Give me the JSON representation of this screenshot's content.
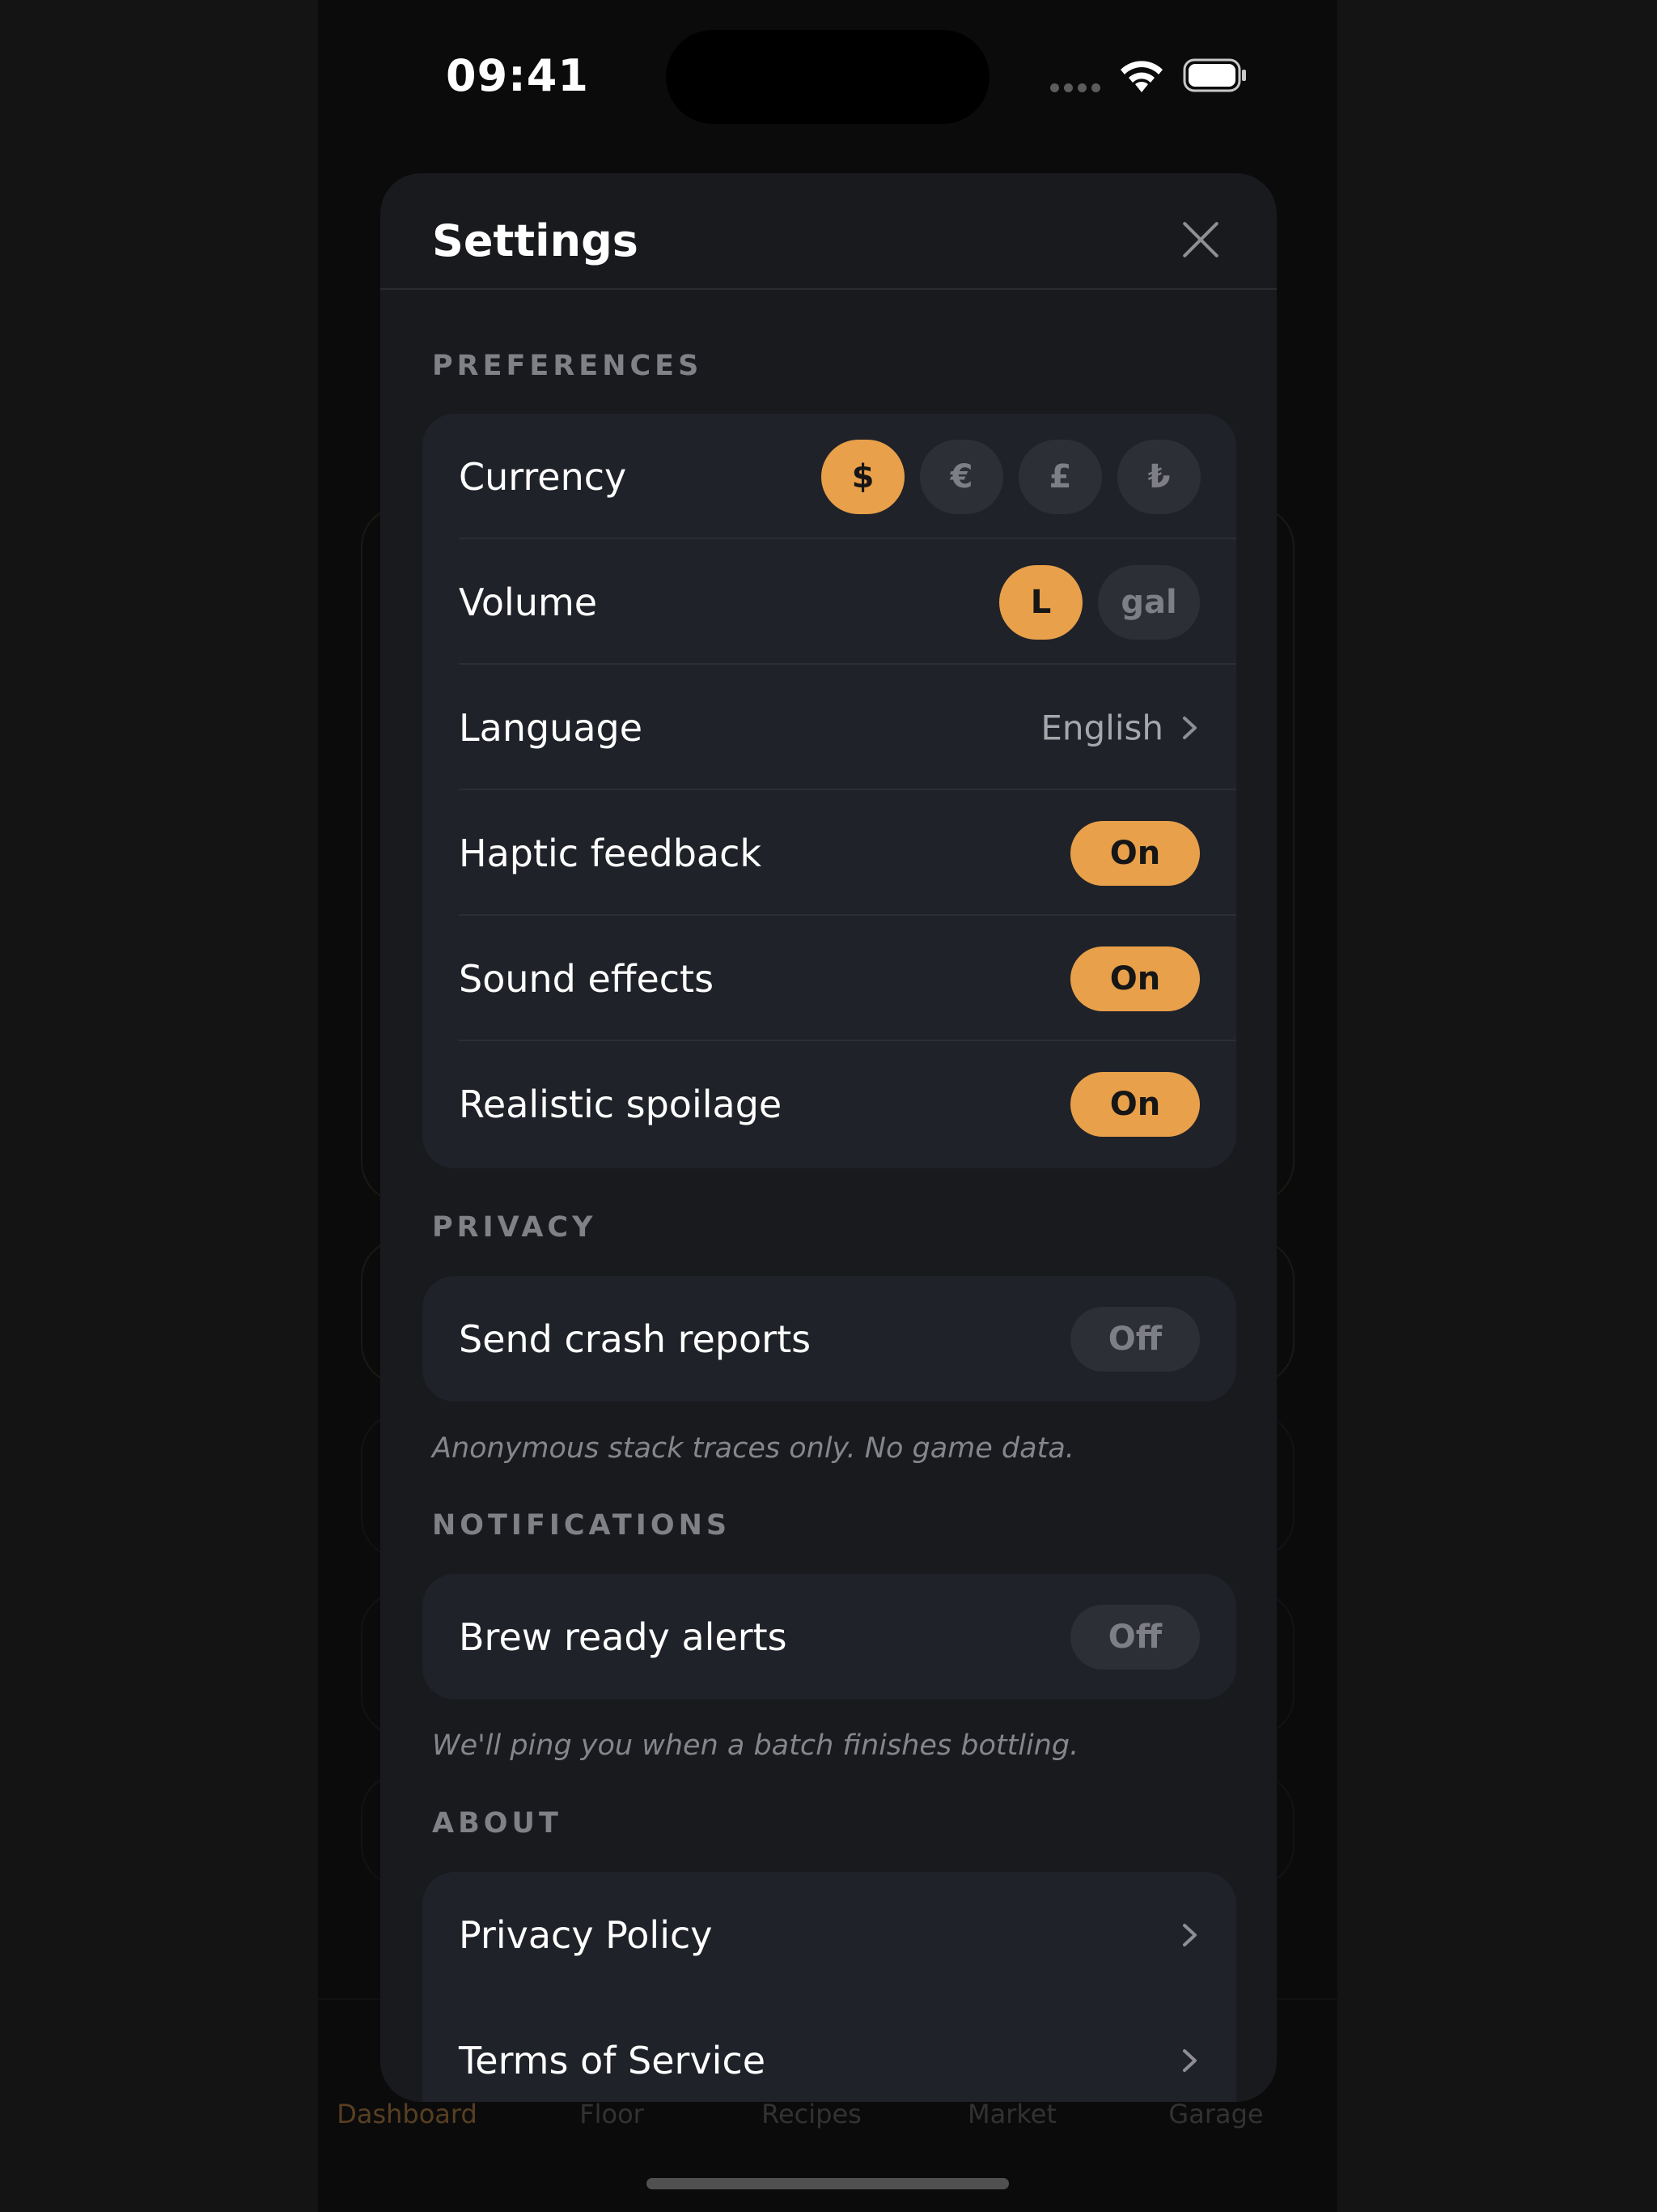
{
  "status_bar": {
    "time": "09:41"
  },
  "background": {
    "tabs": [
      "Dashboard",
      "Floor",
      "Recipes",
      "Market",
      "Garage"
    ],
    "active_tab": "Dashboard"
  },
  "settings": {
    "title": "Settings",
    "sections": {
      "preferences": {
        "label": "PREFERENCES",
        "currency": {
          "label": "Currency",
          "options": [
            "$",
            "€",
            "£",
            "₺"
          ],
          "selected": "$"
        },
        "volume": {
          "label": "Volume",
          "options": [
            "L",
            "gal"
          ],
          "selected": "L"
        },
        "language": {
          "label": "Language",
          "value": "English"
        },
        "haptic": {
          "label": "Haptic feedback",
          "state": "On"
        },
        "sound": {
          "label": "Sound effects",
          "state": "On"
        },
        "spoilage": {
          "label": "Realistic spoilage",
          "state": "On"
        }
      },
      "privacy": {
        "label": "PRIVACY",
        "crash_reports": {
          "label": "Send crash reports",
          "state": "Off"
        },
        "footnote": "Anonymous stack traces only. No game data."
      },
      "notifications": {
        "label": "NOTIFICATIONS",
        "brew_alerts": {
          "label": "Brew ready alerts",
          "state": "Off"
        },
        "footnote": "We'll ping you when a batch finishes bottling."
      },
      "about": {
        "label": "ABOUT",
        "privacy_policy": {
          "label": "Privacy Policy"
        },
        "terms": {
          "label": "Terms of Service"
        }
      }
    }
  },
  "colors": {
    "accent": "#e8a04a",
    "sheet": "#191a1e",
    "group": "#202229",
    "off_pill": "#2d2f36"
  }
}
